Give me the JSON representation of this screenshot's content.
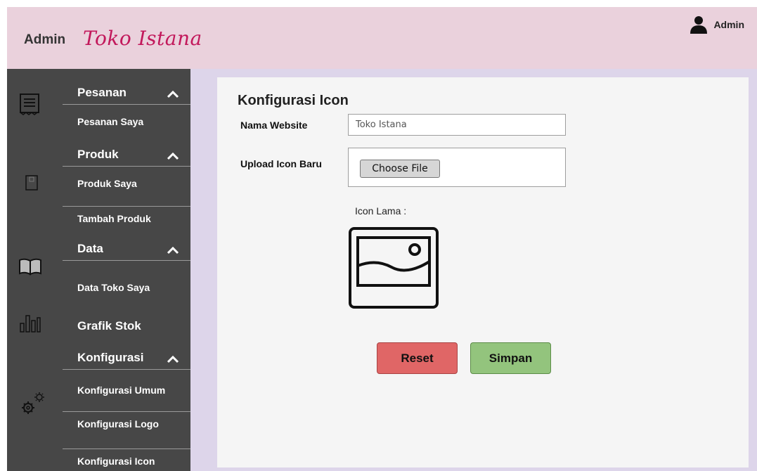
{
  "header": {
    "admin_label": "Admin",
    "brand": "Toko Istana",
    "user_name": "Admin",
    "user_icon": "user-icon"
  },
  "sidebar": {
    "icons": [
      "receipt-icon",
      "tag-icon",
      "book-icon",
      "chart-icon",
      "gears-icon"
    ],
    "groups": [
      {
        "label": "Pesanan",
        "items": [
          "Pesanan Saya"
        ]
      },
      {
        "label": "Produk",
        "items": [
          "Produk Saya",
          "Tambah Produk"
        ]
      },
      {
        "label": "Data",
        "items": [
          "Data Toko Saya"
        ]
      },
      {
        "label": "Grafik Stok",
        "items": []
      },
      {
        "label": "Konfigurasi",
        "items": [
          "Konfigurasi Umum",
          "Konfigurasi Logo",
          "Konfigurasi Icon"
        ]
      }
    ]
  },
  "main": {
    "title": "Konfigurasi Icon",
    "nama_website_label": "Nama Website",
    "nama_website_value": "Toko Istana",
    "upload_label": "Upload Icon Baru",
    "choose_file": "Choose File",
    "icon_lama_label": "Icon Lama :",
    "reset_label": "Reset",
    "save_label": "Simpan"
  },
  "colors": {
    "header_bg": "#ead1dc",
    "sidebar_bg": "#474747",
    "main_bg": "#ddd5ea",
    "reset": "#e06666",
    "save": "#93c47d"
  }
}
